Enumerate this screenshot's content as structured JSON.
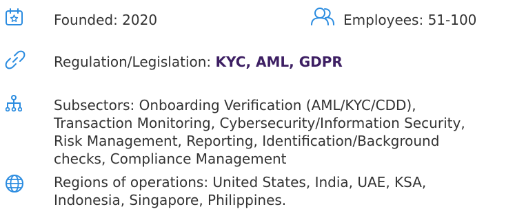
{
  "accent_color": "#2b8ce0",
  "strong_color": "#3d1f63",
  "founded": {
    "icon": "calendar-star-icon",
    "label": "Founded: 2020"
  },
  "employees": {
    "icon": "people-icon",
    "label": "Employees: 51-100"
  },
  "regulation": {
    "icon": "link-icon",
    "label": "Regulation/Legislation: ",
    "value": "KYC, AML, GDPR"
  },
  "subsectors": {
    "icon": "hierarchy-icon",
    "lines": [
      "Subsectors: Onboarding Verification (AML/KYC/CDD),",
      "Transaction Monitoring, Cybersecurity/Information Security,",
      "Risk Management, Reporting, Identification/Background",
      "checks, Compliance Management"
    ]
  },
  "regions": {
    "icon": "globe-icon",
    "lines": [
      "Regions of operations: United States, India, UAE, KSA,",
      "Indonesia, Singapore, Philippines."
    ]
  }
}
